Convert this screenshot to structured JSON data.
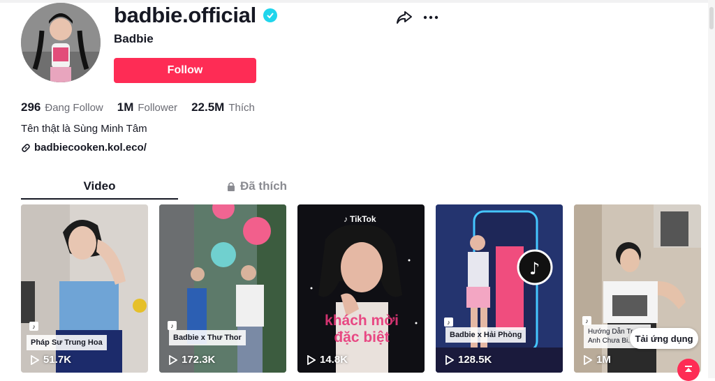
{
  "profile": {
    "username": "badbie.official",
    "nickname": "Badbie",
    "follow_label": "Follow",
    "bio": "Tên thật là Sùng Minh Tâm",
    "link": "badbiecooken.kol.eco/",
    "verified_icon": "verified-badge-icon"
  },
  "stats": [
    {
      "value": "296",
      "label": "Đang Follow"
    },
    {
      "value": "1M",
      "label": "Follower"
    },
    {
      "value": "22.5M",
      "label": "Thích"
    }
  ],
  "tabs": {
    "video": "Video",
    "liked": "Đã thích"
  },
  "videos": [
    {
      "caption": "Pháp Sư Trung Hoa",
      "views": "51.7K"
    },
    {
      "caption": "Badbie x Thư Thor",
      "views": "172.3K"
    },
    {
      "caption": "khách mời đặc biệt",
      "views": "14.8K",
      "brand": "TikTok"
    },
    {
      "caption": "Badbie x Hải Phòng",
      "views": "128.5K"
    },
    {
      "caption": "Hướng Dẫn Tr... Anh Chưa Bi...",
      "views": "1M"
    }
  ],
  "floating": {
    "app_label": "Tải ứng dụng"
  },
  "colors": {
    "accent": "#fe2c55",
    "verified": "#20d5ec"
  }
}
